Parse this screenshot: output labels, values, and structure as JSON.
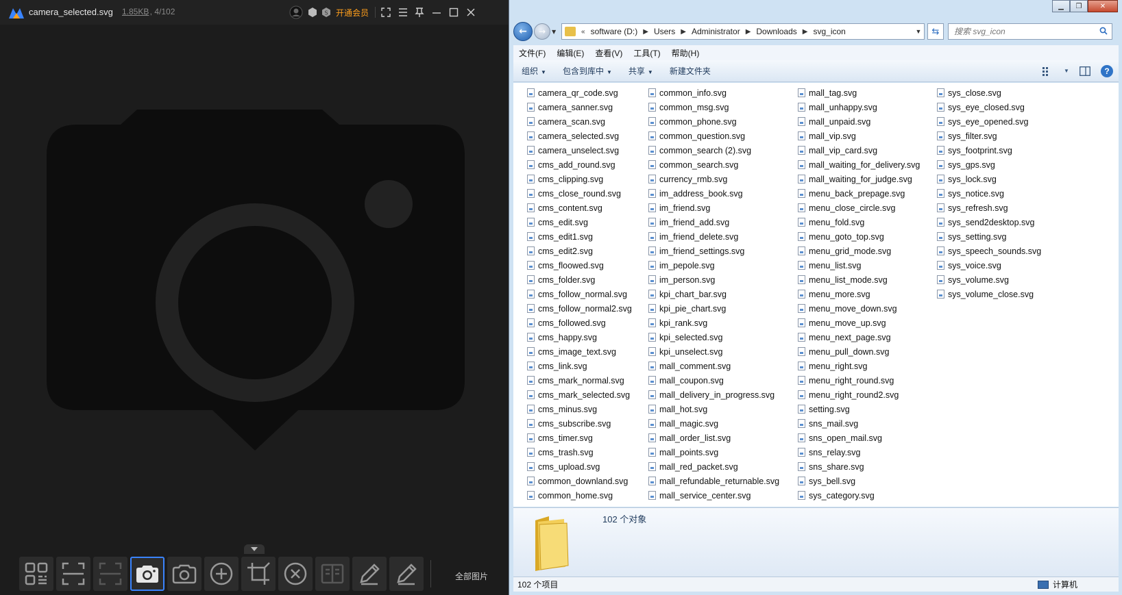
{
  "viewer": {
    "filename": "camera_selected.svg",
    "filesize": "1.85KB",
    "counter": ", , 4/102",
    "vip_label": "开通会员",
    "all_images_label": "全部图片",
    "accent_color": "#3a84ff",
    "toolbar": [
      {
        "name": "grid-view-button",
        "icon": "grid-icon"
      },
      {
        "name": "fit-screen-button",
        "icon": "fit-screen-icon"
      },
      {
        "name": "actual-size-button",
        "icon": "actual-size-icon",
        "disabled": true
      },
      {
        "name": "screenshot-button",
        "icon": "camera-icon",
        "active": true
      },
      {
        "name": "ocr-button",
        "icon": "camera-outline-icon"
      },
      {
        "name": "zoom-in-button",
        "icon": "zoom-in-icon"
      },
      {
        "name": "crop-button",
        "icon": "crop-icon"
      },
      {
        "name": "delete-button",
        "icon": "close-circle-icon"
      },
      {
        "name": "compare-button",
        "icon": "book-icon",
        "disabled": true
      },
      {
        "name": "edit-button",
        "icon": "pencil-icon"
      },
      {
        "name": "annotate-button",
        "icon": "pencil-icon"
      }
    ]
  },
  "explorer": {
    "breadcrumbs": [
      "software (D:)",
      "Users",
      "Administrator",
      "Downloads",
      "svg_icon"
    ],
    "search_placeholder": "搜索 svg_icon",
    "menu": [
      "文件(F)",
      "编辑(E)",
      "查看(V)",
      "工具(T)",
      "帮助(H)"
    ],
    "commands": [
      {
        "label": "组织",
        "dropdown": true
      },
      {
        "label": "包含到库中",
        "dropdown": true
      },
      {
        "label": "共享",
        "dropdown": true
      },
      {
        "label": "新建文件夹",
        "dropdown": false
      }
    ],
    "object_count": "102 个对象",
    "status_left": "102 个项目",
    "status_right": "计算机",
    "files": [
      "camera_qr_code.svg",
      "camera_sanner.svg",
      "camera_scan.svg",
      "camera_selected.svg",
      "camera_unselect.svg",
      "cms_add_round.svg",
      "cms_clipping.svg",
      "cms_close_round.svg",
      "cms_content.svg",
      "cms_edit.svg",
      "cms_edit1.svg",
      "cms_edit2.svg",
      "cms_floowed.svg",
      "cms_folder.svg",
      "cms_follow_normal.svg",
      "cms_follow_normal2.svg",
      "cms_followed.svg",
      "cms_happy.svg",
      "cms_image_text.svg",
      "cms_link.svg",
      "cms_mark_normal.svg",
      "cms_mark_selected.svg",
      "cms_minus.svg",
      "cms_subscribe.svg",
      "cms_timer.svg",
      "cms_trash.svg",
      "cms_upload.svg",
      "common_downland.svg",
      "common_home.svg",
      "common_info.svg",
      "common_msg.svg",
      "common_phone.svg",
      "common_question.svg",
      "common_search (2).svg",
      "common_search.svg",
      "currency_rmb.svg",
      "im_address_book.svg",
      "im_friend.svg",
      "im_friend_add.svg",
      "im_friend_delete.svg",
      "im_friend_settings.svg",
      "im_pepole.svg",
      "im_person.svg",
      "kpi_chart_bar.svg",
      "kpi_pie_chart.svg",
      "kpi_rank.svg",
      "kpi_selected.svg",
      "kpi_unselect.svg",
      "mall_comment.svg",
      "mall_coupon.svg",
      "mall_delivery_in_progress.svg",
      "mall_hot.svg",
      "mall_magic.svg",
      "mall_order_list.svg",
      "mall_points.svg",
      "mall_red_packet.svg",
      "mall_refundable_returnable.svg",
      "mall_service_center.svg",
      "mall_tag.svg",
      "mall_unhappy.svg",
      "mall_unpaid.svg",
      "mall_vip.svg",
      "mall_vip_card.svg",
      "mall_waiting_for_delivery.svg",
      "mall_waiting_for_judge.svg",
      "menu_back_prepage.svg",
      "menu_close_circle.svg",
      "menu_fold.svg",
      "menu_goto_top.svg",
      "menu_grid_mode.svg",
      "menu_list.svg",
      "menu_list_mode.svg",
      "menu_more.svg",
      "menu_move_down.svg",
      "menu_move_up.svg",
      "menu_next_page.svg",
      "menu_pull_down.svg",
      "menu_right.svg",
      "menu_right_round.svg",
      "menu_right_round2.svg",
      "setting.svg",
      "sns_mail.svg",
      "sns_open_mail.svg",
      "sns_relay.svg",
      "sns_share.svg",
      "sys_bell.svg",
      "sys_category.svg",
      "sys_close.svg",
      "sys_eye_closed.svg",
      "sys_eye_opened.svg",
      "sys_filter.svg",
      "sys_footprint.svg",
      "sys_gps.svg",
      "sys_lock.svg",
      "sys_notice.svg",
      "sys_refresh.svg",
      "sys_send2desktop.svg",
      "sys_setting.svg",
      "sys_speech_sounds.svg",
      "sys_voice.svg",
      "sys_volume.svg",
      "sys_volume_close.svg"
    ]
  }
}
